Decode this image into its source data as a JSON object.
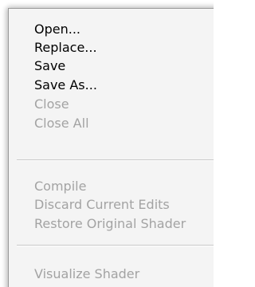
{
  "menu": {
    "items": [
      {
        "label": "Open...",
        "enabled": true
      },
      {
        "label": "Replace...",
        "enabled": true
      },
      {
        "label": "Save",
        "enabled": true
      },
      {
        "label": "Save As...",
        "enabled": true
      },
      {
        "label": "Close",
        "enabled": false
      },
      {
        "label": "Close All",
        "enabled": false
      },
      {
        "label": "Compile",
        "enabled": false
      },
      {
        "label": "Discard Current Edits",
        "enabled": false
      },
      {
        "label": "Restore Original Shader",
        "enabled": false
      },
      {
        "label": "Visualize Shader",
        "enabled": false
      }
    ]
  },
  "colors": {
    "menu_background": "#f4f4f4",
    "enabled_text": "#000000",
    "disabled_text": "#a3a3a3",
    "separator": "#c8c8c8"
  }
}
